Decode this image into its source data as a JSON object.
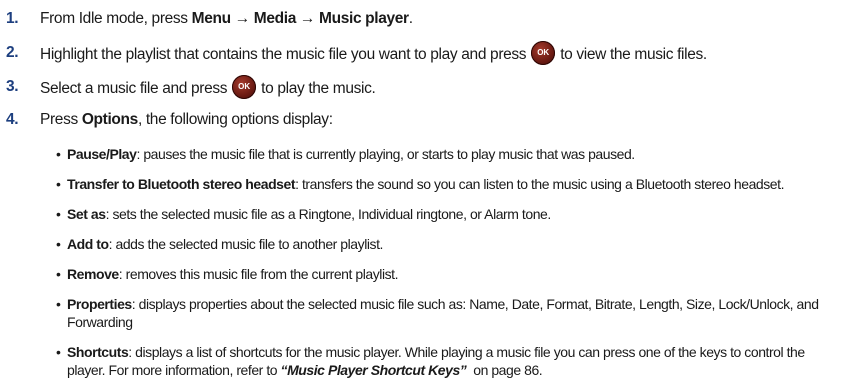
{
  "steps": [
    {
      "num": "1.",
      "pre": "From Idle mode, press ",
      "path": "Menu → Media → Music player",
      "post": "."
    },
    {
      "num": "2.",
      "pre": "Highlight the playlist that contains the music file you want to play and press",
      "post": "to view the music files."
    },
    {
      "num": "3.",
      "pre": "Select a music file and press",
      "post": "to play the music."
    },
    {
      "num": "4.",
      "pre": "Press ",
      "bold": "Options",
      "post": ", the following options display:"
    }
  ],
  "ok_label": "OK",
  "options": [
    {
      "term": "Pause/Play",
      "desc": ": pauses the music file that is currently playing, or starts to play music that was paused."
    },
    {
      "term": "Transfer to Bluetooth stereo headset",
      "desc": ": transfers the sound so you can listen to the music using a Bluetooth stereo headset."
    },
    {
      "term": "Set as",
      "desc": ": sets the selected music file as a Ringtone, Individual ringtone, or Alarm tone."
    },
    {
      "term": "Add to",
      "desc": ": adds the selected music file to another playlist."
    },
    {
      "term": "Remove",
      "desc": ": removes this music file from the current playlist."
    },
    {
      "term": "Properties",
      "desc": ": displays properties about the selected music file such as: Name, Date, Format, Bitrate, Length, Size, Lock/Unlock, and Forwarding"
    },
    {
      "term": "Shortcuts",
      "desc": ": displays a list of shortcuts for the music player. While playing a music file you can press one of the keys to control the player. For more information, refer to ",
      "ref": "“Music Player Shortcut Keys”",
      "tail": "  on page 86."
    }
  ],
  "colors": {
    "step_number": "#1d3f7f",
    "ok_button": "#6e1c14",
    "text": "#1a1a1a"
  }
}
